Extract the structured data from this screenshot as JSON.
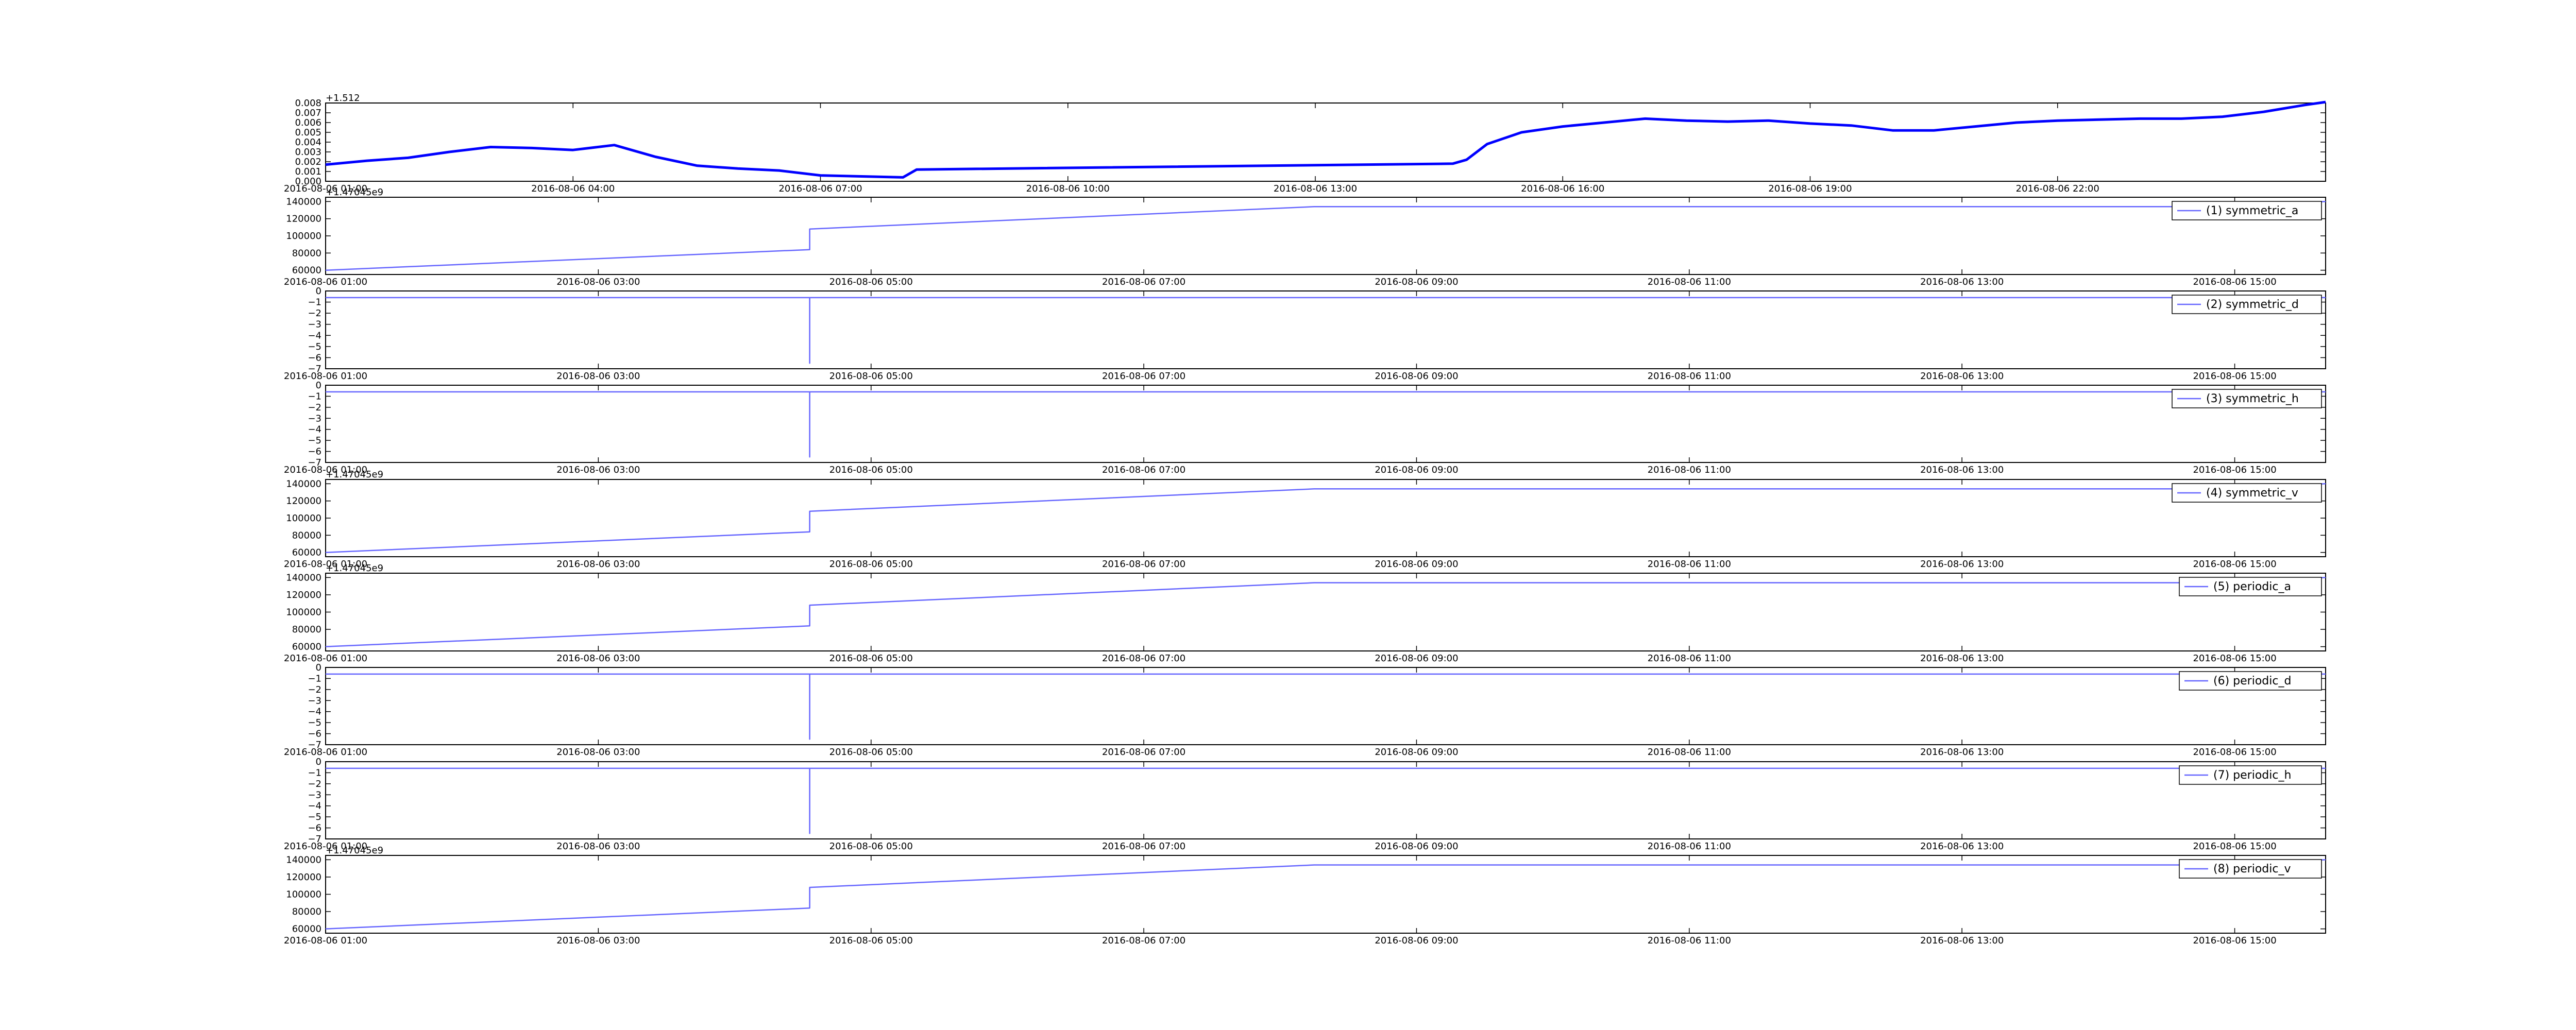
{
  "colors": {
    "series": "#0000ff",
    "series_light": "#6666ff",
    "axes": "#000000",
    "background": "#ffffff"
  },
  "chart_data": [
    {
      "type": "line",
      "offset_label": "+1.512",
      "series": [
        {
          "name": "",
          "style": "thick",
          "points": [
            [
              "2016-08-06 01:00",
              0.0017
            ],
            [
              "2016-08-06 01:30",
              0.0021
            ],
            [
              "2016-08-06 02:00",
              0.0024
            ],
            [
              "2016-08-06 02:30",
              0.003
            ],
            [
              "2016-08-06 03:00",
              0.0035
            ],
            [
              "2016-08-06 03:30",
              0.0034
            ],
            [
              "2016-08-06 04:00",
              0.0032
            ],
            [
              "2016-08-06 04:30",
              0.0037
            ],
            [
              "2016-08-06 05:00",
              0.0025
            ],
            [
              "2016-08-06 05:30",
              0.0016
            ],
            [
              "2016-08-06 06:00",
              0.0013
            ],
            [
              "2016-08-06 06:30",
              0.0011
            ],
            [
              "2016-08-06 07:00",
              0.0006
            ],
            [
              "2016-08-06 07:30",
              0.0005
            ],
            [
              "2016-08-06 08:00",
              0.0004
            ],
            [
              "2016-08-06 08:10",
              0.0012
            ],
            [
              "2016-08-06 14:40",
              0.0018
            ],
            [
              "2016-08-06 14:50",
              0.0022
            ],
            [
              "2016-08-06 15:05",
              0.0038
            ],
            [
              "2016-08-06 15:30",
              0.005
            ],
            [
              "2016-08-06 16:00",
              0.0056
            ],
            [
              "2016-08-06 16:30",
              0.006
            ],
            [
              "2016-08-06 17:00",
              0.0064
            ],
            [
              "2016-08-06 17:30",
              0.0062
            ],
            [
              "2016-08-06 18:00",
              0.0061
            ],
            [
              "2016-08-06 18:30",
              0.0062
            ],
            [
              "2016-08-06 19:00",
              0.0059
            ],
            [
              "2016-08-06 19:30",
              0.0057
            ],
            [
              "2016-08-06 20:00",
              0.0052
            ],
            [
              "2016-08-06 20:30",
              0.0052
            ],
            [
              "2016-08-06 21:00",
              0.0056
            ],
            [
              "2016-08-06 21:30",
              0.006
            ],
            [
              "2016-08-06 22:00",
              0.0062
            ],
            [
              "2016-08-06 22:30",
              0.0063
            ],
            [
              "2016-08-06 23:00",
              0.0064
            ],
            [
              "2016-08-06 23:30",
              0.0064
            ],
            [
              "2016-08-07 00:00",
              0.0066
            ],
            [
              "2016-08-07 00:30",
              0.0071
            ],
            [
              "2016-08-07 01:00",
              0.0078
            ],
            [
              "2016-08-07 01:15",
              0.0081
            ]
          ]
        }
      ],
      "xlim": [
        "2016-08-06 01:00",
        "2016-08-07 01:15"
      ],
      "ylim": [
        0.0,
        0.008
      ],
      "yticks": [
        0.0,
        0.001,
        0.002,
        0.003,
        0.004,
        0.005,
        0.006,
        0.007,
        0.008
      ],
      "ytick_labels": [
        "0.000",
        "0.001",
        "0.002",
        "0.003",
        "0.004",
        "0.005",
        "0.006",
        "0.007",
        "0.008"
      ],
      "xticks": [
        "2016-08-06 01:00",
        "2016-08-06 04:00",
        "2016-08-06 07:00",
        "2016-08-06 10:00",
        "2016-08-06 13:00",
        "2016-08-06 16:00",
        "2016-08-06 19:00",
        "2016-08-06 22:00"
      ],
      "xtick_labels": [
        "2016-08-06 01:00",
        "2016-08-06 04:00",
        "2016-08-06 07:00",
        "2016-08-06 10:00",
        "2016-08-06 13:00",
        "2016-08-06 16:00",
        "2016-08-06 19:00",
        "2016-08-06 22:00"
      ],
      "legend": "",
      "grid": false
    },
    {
      "type": "line",
      "offset_label": "+1.47045e9",
      "series": [
        {
          "name": "(1) symmetric_a",
          "style": "thin",
          "points": [
            [
              "2016-08-06 01:00",
              60000
            ],
            [
              "2016-08-06 04:33",
              84000
            ],
            [
              "2016-08-06 04:33",
              108000
            ],
            [
              "2016-08-06 08:15",
              134000
            ],
            [
              "2016-08-06 14:52",
              134000
            ],
            [
              "2016-08-06 15:40",
              140000
            ]
          ]
        }
      ],
      "xlim": [
        "2016-08-06 01:00",
        "2016-08-06 15:40"
      ],
      "ylim": [
        55000,
        145000
      ],
      "yticks": [
        60000,
        80000,
        100000,
        120000,
        140000
      ],
      "ytick_labels": [
        "60000",
        "80000",
        "100000",
        "120000",
        "140000"
      ],
      "xticks": [
        "2016-08-06 01:00",
        "2016-08-06 03:00",
        "2016-08-06 05:00",
        "2016-08-06 07:00",
        "2016-08-06 09:00",
        "2016-08-06 11:00",
        "2016-08-06 13:00",
        "2016-08-06 15:00"
      ],
      "xtick_labels": [
        "2016-08-06 01:00",
        "2016-08-06 03:00",
        "2016-08-06 05:00",
        "2016-08-06 07:00",
        "2016-08-06 09:00",
        "2016-08-06 11:00",
        "2016-08-06 13:00",
        "2016-08-06 15:00"
      ],
      "legend": "top-right",
      "grid": false
    },
    {
      "type": "line",
      "offset_label": "",
      "series": [
        {
          "name": "(2) symmetric_d",
          "style": "thin",
          "points": [
            [
              "2016-08-06 01:00",
              -0.6
            ],
            [
              "2016-08-06 04:33",
              -0.6
            ],
            [
              "2016-08-06 04:33",
              -6.5
            ],
            [
              "2016-08-06 04:33",
              -0.6
            ],
            [
              "2016-08-06 15:40",
              -0.6
            ]
          ]
        }
      ],
      "xlim": [
        "2016-08-06 01:00",
        "2016-08-06 15:40"
      ],
      "ylim": [
        -7,
        0
      ],
      "yticks": [
        0,
        -1,
        -2,
        -3,
        -4,
        -5,
        -6,
        -7
      ],
      "ytick_labels": [
        "0",
        "−1",
        "−2",
        "−3",
        "−4",
        "−5",
        "−6",
        "−7"
      ],
      "xticks": [
        "2016-08-06 01:00",
        "2016-08-06 03:00",
        "2016-08-06 05:00",
        "2016-08-06 07:00",
        "2016-08-06 09:00",
        "2016-08-06 11:00",
        "2016-08-06 13:00",
        "2016-08-06 15:00"
      ],
      "xtick_labels": [
        "2016-08-06 01:00",
        "2016-08-06 03:00",
        "2016-08-06 05:00",
        "2016-08-06 07:00",
        "2016-08-06 09:00",
        "2016-08-06 11:00",
        "2016-08-06 13:00",
        "2016-08-06 15:00"
      ],
      "legend": "top-right",
      "grid": false
    },
    {
      "type": "line",
      "offset_label": "",
      "series": [
        {
          "name": "(3) symmetric_h",
          "style": "thin",
          "points": [
            [
              "2016-08-06 01:00",
              -0.6
            ],
            [
              "2016-08-06 04:33",
              -0.6
            ],
            [
              "2016-08-06 04:33",
              -6.5
            ],
            [
              "2016-08-06 04:33",
              -0.6
            ],
            [
              "2016-08-06 15:40",
              -0.6
            ]
          ]
        }
      ],
      "xlim": [
        "2016-08-06 01:00",
        "2016-08-06 15:40"
      ],
      "ylim": [
        -7,
        0
      ],
      "yticks": [
        0,
        -1,
        -2,
        -3,
        -4,
        -5,
        -6,
        -7
      ],
      "ytick_labels": [
        "0",
        "−1",
        "−2",
        "−3",
        "−4",
        "−5",
        "−6",
        "−7"
      ],
      "xticks": [
        "2016-08-06 01:00",
        "2016-08-06 03:00",
        "2016-08-06 05:00",
        "2016-08-06 07:00",
        "2016-08-06 09:00",
        "2016-08-06 11:00",
        "2016-08-06 13:00",
        "2016-08-06 15:00"
      ],
      "xtick_labels": [
        "2016-08-06 01:00",
        "2016-08-06 03:00",
        "2016-08-06 05:00",
        "2016-08-06 07:00",
        "2016-08-06 09:00",
        "2016-08-06 11:00",
        "2016-08-06 13:00",
        "2016-08-06 15:00"
      ],
      "legend": "top-right",
      "grid": false
    },
    {
      "type": "line",
      "offset_label": "+1.47045e9",
      "series": [
        {
          "name": "(4) symmetric_v",
          "style": "thin",
          "points": [
            [
              "2016-08-06 01:00",
              60000
            ],
            [
              "2016-08-06 04:33",
              84000
            ],
            [
              "2016-08-06 04:33",
              108000
            ],
            [
              "2016-08-06 08:15",
              134000
            ],
            [
              "2016-08-06 14:52",
              134000
            ],
            [
              "2016-08-06 15:40",
              140000
            ]
          ]
        }
      ],
      "xlim": [
        "2016-08-06 01:00",
        "2016-08-06 15:40"
      ],
      "ylim": [
        55000,
        145000
      ],
      "yticks": [
        60000,
        80000,
        100000,
        120000,
        140000
      ],
      "ytick_labels": [
        "60000",
        "80000",
        "100000",
        "120000",
        "140000"
      ],
      "xticks": [
        "2016-08-06 01:00",
        "2016-08-06 03:00",
        "2016-08-06 05:00",
        "2016-08-06 07:00",
        "2016-08-06 09:00",
        "2016-08-06 11:00",
        "2016-08-06 13:00",
        "2016-08-06 15:00"
      ],
      "xtick_labels": [
        "2016-08-06 01:00",
        "2016-08-06 03:00",
        "2016-08-06 05:00",
        "2016-08-06 07:00",
        "2016-08-06 09:00",
        "2016-08-06 11:00",
        "2016-08-06 13:00",
        "2016-08-06 15:00"
      ],
      "legend": "top-right",
      "grid": false
    },
    {
      "type": "line",
      "offset_label": "+1.47045e9",
      "series": [
        {
          "name": "(5) periodic_a",
          "style": "thin",
          "points": [
            [
              "2016-08-06 01:00",
              60000
            ],
            [
              "2016-08-06 04:33",
              84000
            ],
            [
              "2016-08-06 04:33",
              108000
            ],
            [
              "2016-08-06 08:15",
              134000
            ],
            [
              "2016-08-06 14:52",
              134000
            ],
            [
              "2016-08-06 15:40",
              140000
            ]
          ]
        }
      ],
      "xlim": [
        "2016-08-06 01:00",
        "2016-08-06 15:40"
      ],
      "ylim": [
        55000,
        145000
      ],
      "yticks": [
        60000,
        80000,
        100000,
        120000,
        140000
      ],
      "ytick_labels": [
        "60000",
        "80000",
        "100000",
        "120000",
        "140000"
      ],
      "xticks": [
        "2016-08-06 01:00",
        "2016-08-06 03:00",
        "2016-08-06 05:00",
        "2016-08-06 07:00",
        "2016-08-06 09:00",
        "2016-08-06 11:00",
        "2016-08-06 13:00",
        "2016-08-06 15:00"
      ],
      "xtick_labels": [
        "2016-08-06 01:00",
        "2016-08-06 03:00",
        "2016-08-06 05:00",
        "2016-08-06 07:00",
        "2016-08-06 09:00",
        "2016-08-06 11:00",
        "2016-08-06 13:00",
        "2016-08-06 15:00"
      ],
      "legend": "top-right",
      "grid": false
    },
    {
      "type": "line",
      "offset_label": "",
      "series": [
        {
          "name": "(6) periodic_d",
          "style": "thin",
          "points": [
            [
              "2016-08-06 01:00",
              -0.6
            ],
            [
              "2016-08-06 04:33",
              -0.6
            ],
            [
              "2016-08-06 04:33",
              -6.5
            ],
            [
              "2016-08-06 04:33",
              -0.6
            ],
            [
              "2016-08-06 15:40",
              -0.6
            ]
          ]
        }
      ],
      "xlim": [
        "2016-08-06 01:00",
        "2016-08-06 15:40"
      ],
      "ylim": [
        -7,
        0
      ],
      "yticks": [
        0,
        -1,
        -2,
        -3,
        -4,
        -5,
        -6,
        -7
      ],
      "ytick_labels": [
        "0",
        "−1",
        "−2",
        "−3",
        "−4",
        "−5",
        "−6",
        "−7"
      ],
      "xticks": [
        "2016-08-06 01:00",
        "2016-08-06 03:00",
        "2016-08-06 05:00",
        "2016-08-06 07:00",
        "2016-08-06 09:00",
        "2016-08-06 11:00",
        "2016-08-06 13:00",
        "2016-08-06 15:00"
      ],
      "xtick_labels": [
        "2016-08-06 01:00",
        "2016-08-06 03:00",
        "2016-08-06 05:00",
        "2016-08-06 07:00",
        "2016-08-06 09:00",
        "2016-08-06 11:00",
        "2016-08-06 13:00",
        "2016-08-06 15:00"
      ],
      "legend": "top-right",
      "grid": false
    },
    {
      "type": "line",
      "offset_label": "",
      "series": [
        {
          "name": "(7) periodic_h",
          "style": "thin",
          "points": [
            [
              "2016-08-06 01:00",
              -0.6
            ],
            [
              "2016-08-06 04:33",
              -0.6
            ],
            [
              "2016-08-06 04:33",
              -6.5
            ],
            [
              "2016-08-06 04:33",
              -0.6
            ],
            [
              "2016-08-06 15:40",
              -0.6
            ]
          ]
        }
      ],
      "xlim": [
        "2016-08-06 01:00",
        "2016-08-06 15:40"
      ],
      "ylim": [
        -7,
        0
      ],
      "yticks": [
        0,
        -1,
        -2,
        -3,
        -4,
        -5,
        -6,
        -7
      ],
      "ytick_labels": [
        "0",
        "−1",
        "−2",
        "−3",
        "−4",
        "−5",
        "−6",
        "−7"
      ],
      "xticks": [
        "2016-08-06 01:00",
        "2016-08-06 03:00",
        "2016-08-06 05:00",
        "2016-08-06 07:00",
        "2016-08-06 09:00",
        "2016-08-06 11:00",
        "2016-08-06 13:00",
        "2016-08-06 15:00"
      ],
      "xtick_labels": [
        "2016-08-06 01:00",
        "2016-08-06 03:00",
        "2016-08-06 05:00",
        "2016-08-06 07:00",
        "2016-08-06 09:00",
        "2016-08-06 11:00",
        "2016-08-06 13:00",
        "2016-08-06 15:00"
      ],
      "legend": "top-right",
      "grid": false
    },
    {
      "type": "line",
      "offset_label": "+1.47045e9",
      "series": [
        {
          "name": "(8) periodic_v",
          "style": "thin",
          "points": [
            [
              "2016-08-06 01:00",
              60000
            ],
            [
              "2016-08-06 04:33",
              84000
            ],
            [
              "2016-08-06 04:33",
              108000
            ],
            [
              "2016-08-06 08:15",
              134000
            ],
            [
              "2016-08-06 14:52",
              134000
            ],
            [
              "2016-08-06 15:40",
              140000
            ]
          ]
        }
      ],
      "xlim": [
        "2016-08-06 01:00",
        "2016-08-06 15:40"
      ],
      "ylim": [
        55000,
        145000
      ],
      "yticks": [
        60000,
        80000,
        100000,
        120000,
        140000
      ],
      "ytick_labels": [
        "60000",
        "80000",
        "100000",
        "120000",
        "140000"
      ],
      "xticks": [
        "2016-08-06 01:00",
        "2016-08-06 03:00",
        "2016-08-06 05:00",
        "2016-08-06 07:00",
        "2016-08-06 09:00",
        "2016-08-06 11:00",
        "2016-08-06 13:00",
        "2016-08-06 15:00"
      ],
      "xtick_labels": [
        "2016-08-06 01:00",
        "2016-08-06 03:00",
        "2016-08-06 05:00",
        "2016-08-06 07:00",
        "2016-08-06 09:00",
        "2016-08-06 11:00",
        "2016-08-06 13:00",
        "2016-08-06 15:00"
      ],
      "legend": "top-right",
      "grid": false
    }
  ]
}
